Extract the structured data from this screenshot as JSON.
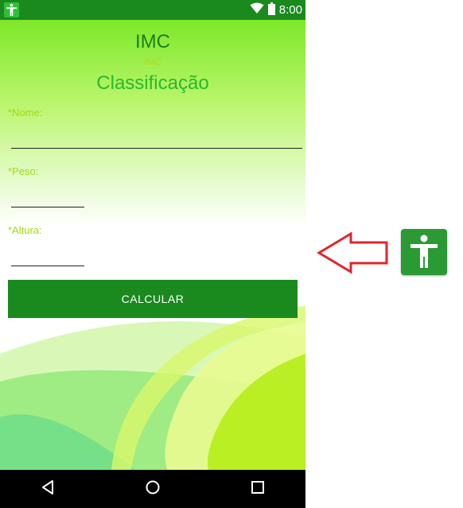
{
  "status_bar": {
    "time": "8:00",
    "icons": [
      "accessibility-icon",
      "wifi-icon",
      "battery-icon"
    ]
  },
  "app": {
    "title": "IMC",
    "subtitle": "IMC",
    "heading": "Classificação"
  },
  "form": {
    "nome_label": "*Nome:",
    "peso_label": "*Peso:",
    "altura_label": "*Altura:",
    "nome_value": "",
    "peso_value": "",
    "altura_value": ""
  },
  "button": {
    "calcular_label": "CALCULAR"
  },
  "navigation": {
    "icons": [
      "back-icon",
      "home-icon",
      "recents-icon"
    ]
  },
  "overlay": {
    "icons": [
      "arrow-left-icon",
      "accessibility-icon"
    ]
  },
  "colors": {
    "primary": "#1a8a1f",
    "accent": "#28b82e",
    "label": "#a3d912",
    "arrow": "#e0242c"
  }
}
